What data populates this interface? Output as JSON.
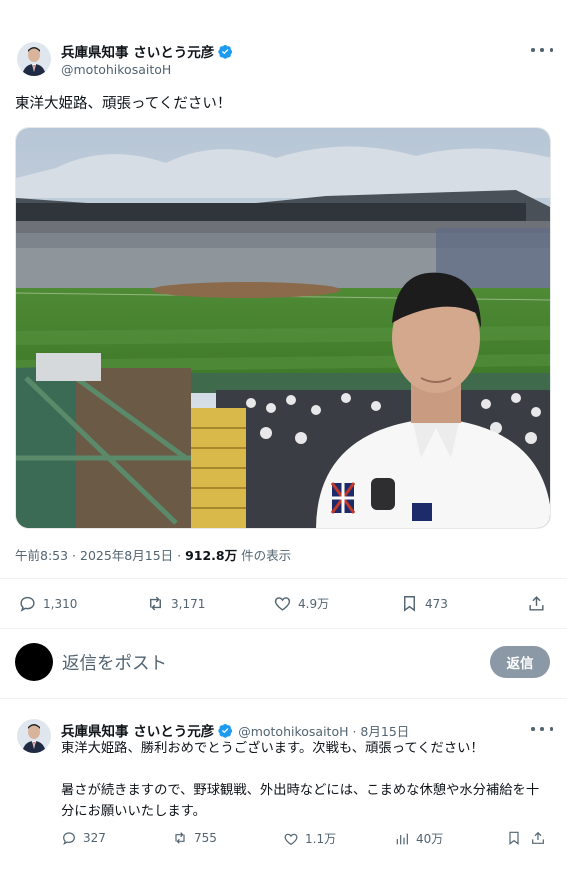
{
  "post": {
    "author_name": "兵庫県知事 さいとう元彦",
    "author_handle": "@motohikosaitoH",
    "text": "東洋大姫路、頑張ってください！",
    "time_prefix": "午前8:53 · 2025年8月15日 · ",
    "views_count": "912.8万",
    "views_suffix": " 件の表示",
    "stats": {
      "replies": "1,310",
      "reposts": "3,171",
      "likes": "4.9万",
      "bookmarks": "473"
    }
  },
  "reply_box": {
    "placeholder": "返信をポスト",
    "button": "返信"
  },
  "thread_reply": {
    "author_name": "兵庫県知事 さいとう元彦",
    "author_handle": "@motohikosaitoH · 8月15日",
    "text": "東洋大姫路、勝利おめでとうございます。次戦も、頑張ってください！\n\n暑さが続きますので、野球観戦、外出時などには、こまめな休憩や水分補給を十分にお願いいたします。",
    "stats": {
      "replies": "327",
      "reposts": "755",
      "likes": "1.1万",
      "views": "40万"
    }
  },
  "colors": {
    "verified": "#1d9bf0",
    "muted": "#536471",
    "reply_button": "#8b98a5"
  }
}
